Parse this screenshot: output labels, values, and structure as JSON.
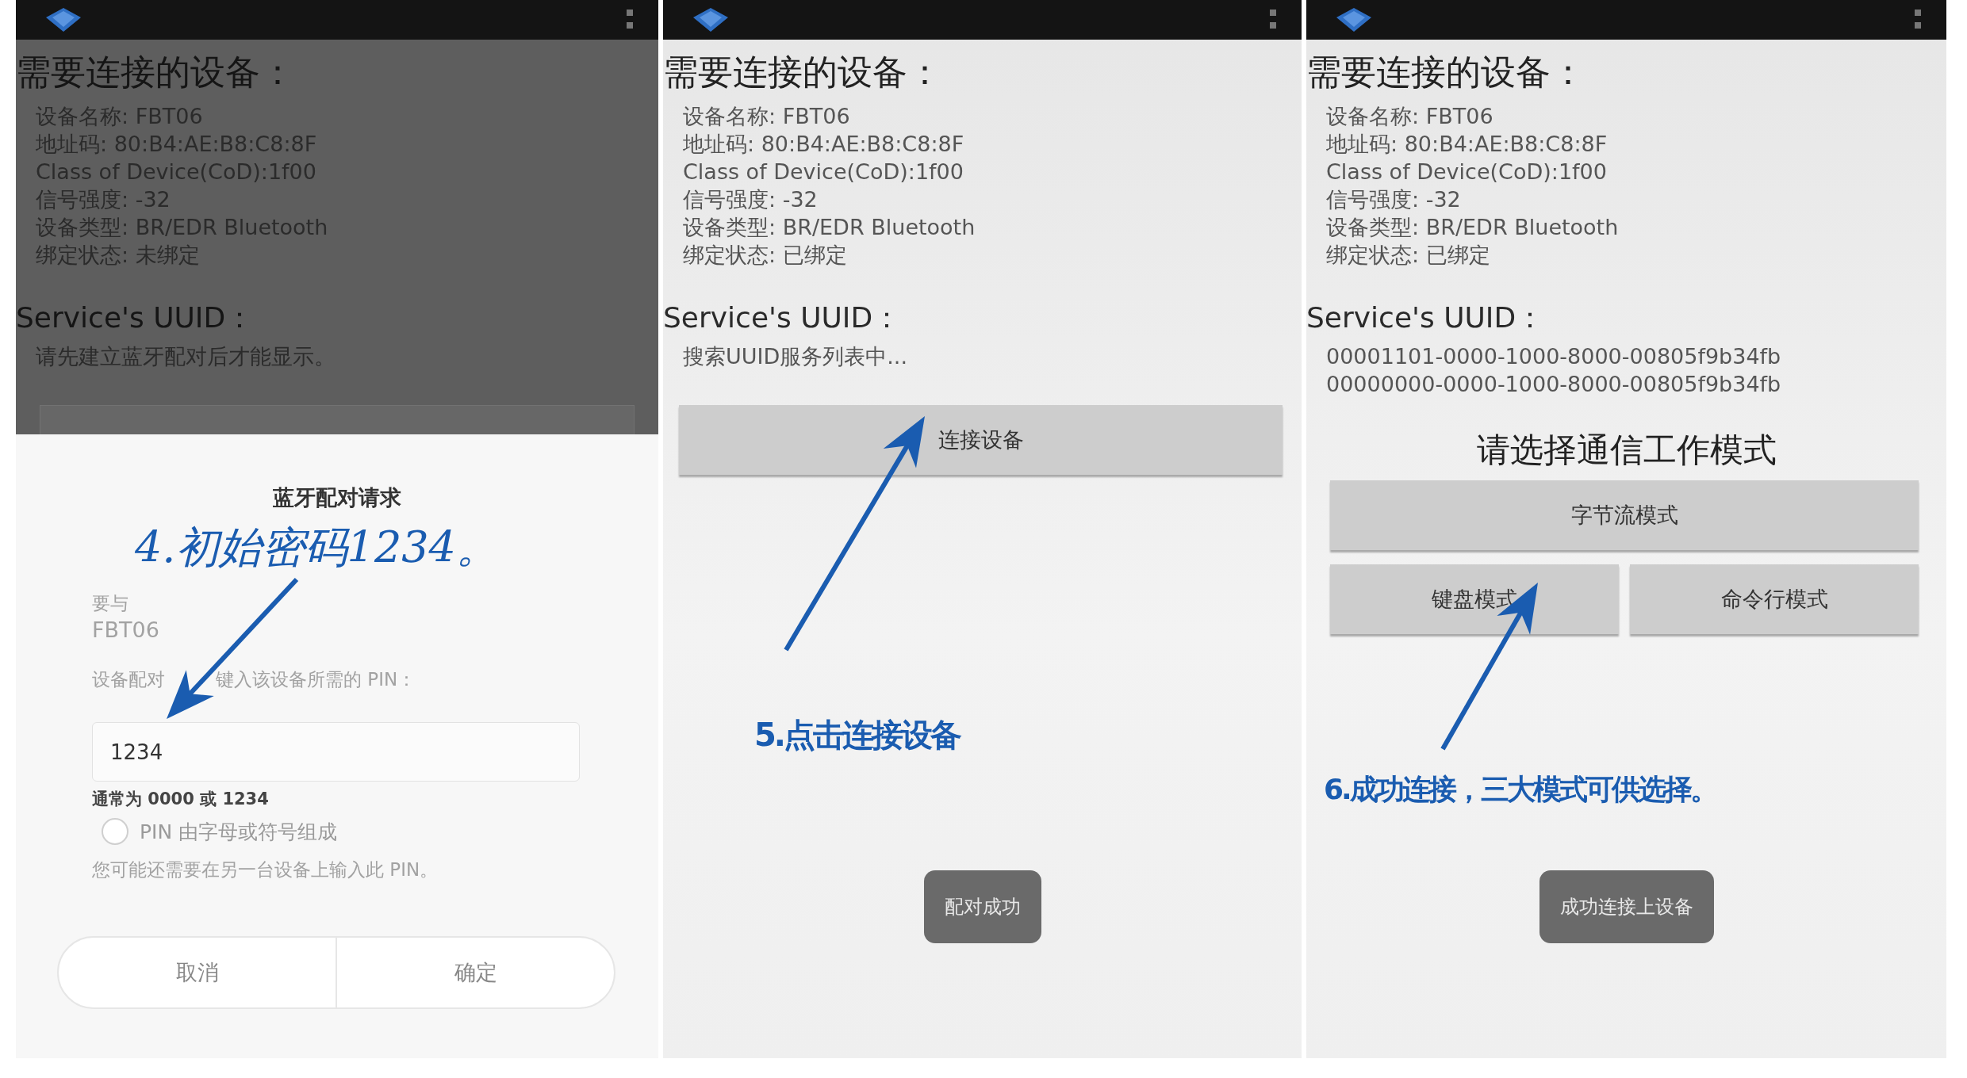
{
  "panels": [
    {
      "kind": "pairing",
      "dimmed": true,
      "device_heading": "需要连接的设备：",
      "details": [
        "设备名称: FBT06",
        "地址码: 80:B4:AE:B8:C8:8F",
        "Class of Device(CoD):1f00",
        "信号强度: -32",
        "设备类型: BR/EDR Bluetooth",
        "绑定状态: 未绑定"
      ],
      "uuid_heading": "Service's UUID：",
      "uuid_lines": [
        "请先建立蓝牙配对后才能显示。"
      ],
      "dialog": {
        "title": "蓝牙配对请求",
        "pair_with": "要与",
        "device": "FBT06",
        "prompt": [
          "设备配对",
          "键入该设备所需的 PIN："
        ],
        "pin_value": "1234",
        "pin_hint": "通常为 0000 或 1234",
        "radio": {
          "label": "PIN 由字母或符号组成",
          "checked": false
        },
        "info": "您可能还需要在另一台设备上输入此 PIN。",
        "buttons": [
          "取消",
          "确定"
        ]
      },
      "annotation": "4.初始密码1234。"
    },
    {
      "kind": "connect",
      "dimmed": false,
      "device_heading": "需要连接的设备：",
      "details": [
        "设备名称: FBT06",
        "地址码: 80:B4:AE:B8:C8:8F",
        "Class of Device(CoD):1f00",
        "信号强度: -32",
        "设备类型: BR/EDR Bluetooth",
        "绑定状态: 已绑定"
      ],
      "uuid_heading": "Service's UUID：",
      "uuid_lines": [
        "搜索UUID服务列表中..."
      ],
      "connect_button": "连接设备",
      "toast": "配对成功",
      "annotation": "5.点击连接设备"
    },
    {
      "kind": "modes",
      "dimmed": false,
      "device_heading": "需要连接的设备：",
      "details": [
        "设备名称: FBT06",
        "地址码: 80:B4:AE:B8:C8:8F",
        "Class of Device(CoD):1f00",
        "信号强度: -32",
        "设备类型: BR/EDR Bluetooth",
        "绑定状态: 已绑定"
      ],
      "uuid_heading": "Service's UUID：",
      "uuid_lines": [
        "00001101-0000-1000-8000-00805f9b34fb",
        "00000000-0000-1000-8000-00805f9b34fb"
      ],
      "mode_heading": "请选择通信工作模式",
      "mode_buttons": [
        "字节流模式",
        "键盘模式",
        "命令行模式"
      ],
      "toast": "成功连接上设备",
      "annotation": "6.成功连接，三大模式可供选择。"
    }
  ]
}
